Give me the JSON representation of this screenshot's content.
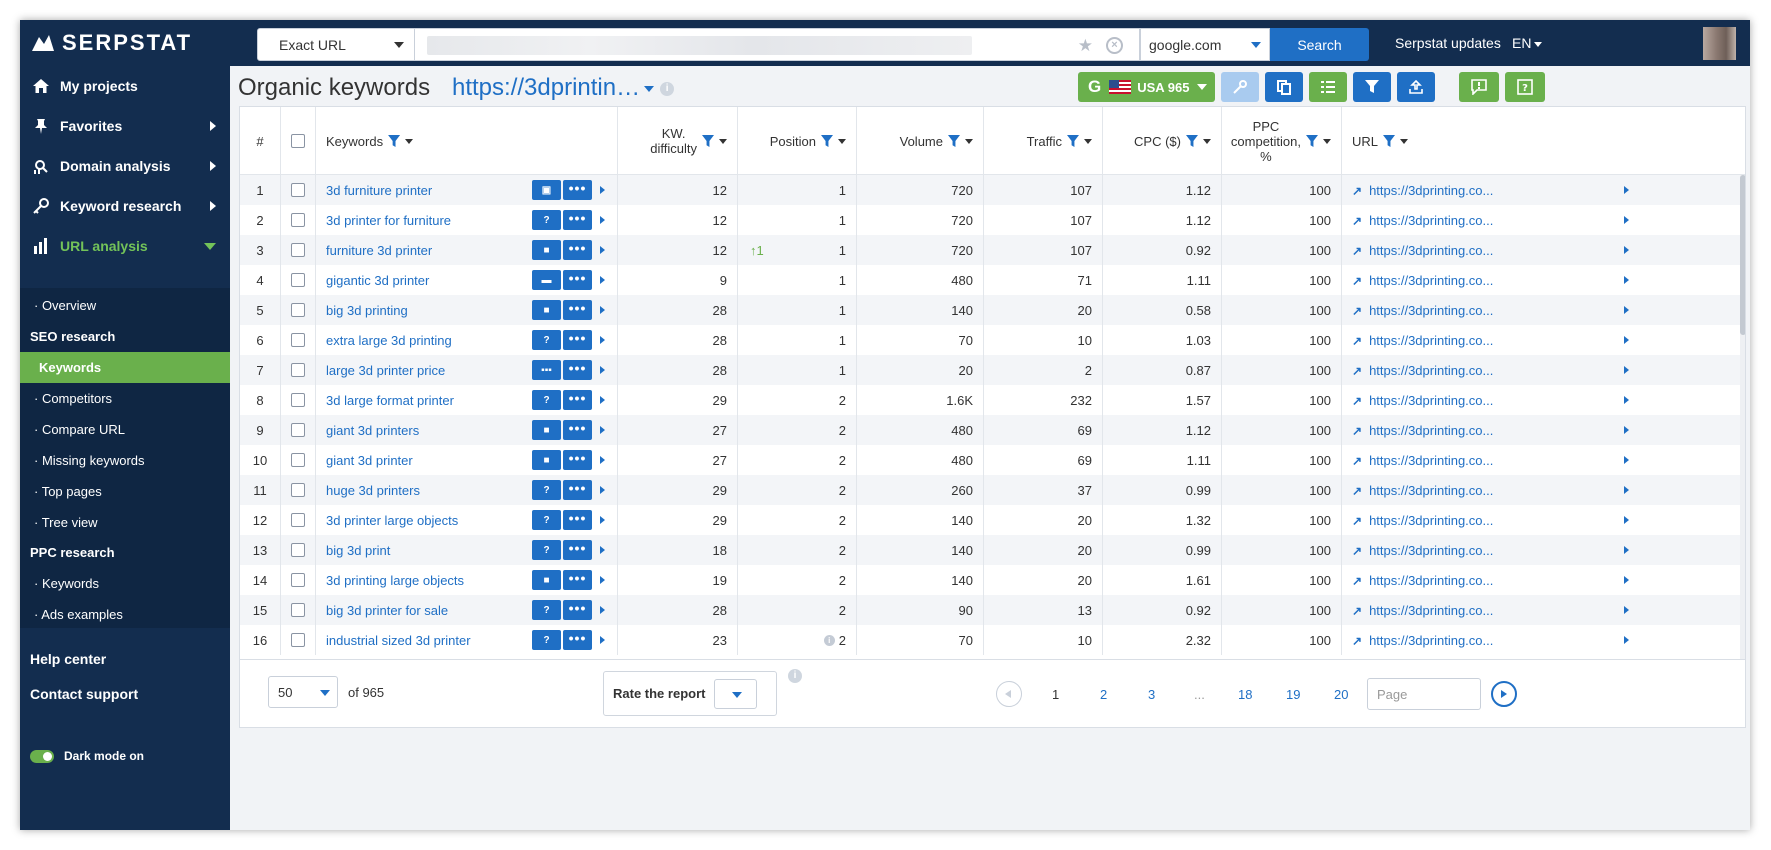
{
  "app": {
    "logo": "SERPSTAT"
  },
  "search": {
    "mode": "Exact URL",
    "engine": "google.com",
    "button": "Search"
  },
  "header": {
    "updates": "Serpstat updates",
    "lang": "EN"
  },
  "sidebar": {
    "items": [
      {
        "label": "My projects",
        "icon": "home-icon"
      },
      {
        "label": "Favorites",
        "icon": "pin-icon"
      },
      {
        "label": "Domain analysis",
        "icon": "domain-analysis-icon"
      },
      {
        "label": "Keyword research",
        "icon": "key-icon"
      },
      {
        "label": "URL analysis",
        "icon": "bar-chart-icon"
      }
    ],
    "sub": {
      "overview": "· Overview",
      "seo_head": "SEO research",
      "keywords": "Keywords",
      "competitors": "· Competitors",
      "compare": "· Compare URL",
      "missing": "· Missing keywords",
      "top_pages": "· Top pages",
      "tree": "· Tree view",
      "ppc_head": "PPC research",
      "ppc_keywords": "· Keywords",
      "ads": "· Ads examples"
    },
    "help": "Help center",
    "contact": "Contact support",
    "dark_mode": "Dark mode on"
  },
  "page": {
    "title": "Organic keywords",
    "url": "https://3dprintin…",
    "region": "USA 965",
    "region_g": "G"
  },
  "table": {
    "headers": {
      "num": "#",
      "keywords": "Keywords",
      "kd1": "KW.",
      "kd2": "difficulty",
      "position": "Position",
      "volume": "Volume",
      "traffic": "Traffic",
      "cpc": "CPC ($)",
      "ppc1": "PPC",
      "ppc2": "competition,",
      "ppc3": "%",
      "url": "URL"
    },
    "rows": [
      {
        "n": "1",
        "kw": "3d furniture printer",
        "serp": "image",
        "kd": "12",
        "change": "",
        "pos": "1",
        "vol": "720",
        "traffic": "107",
        "cpc": "1.12",
        "ppc": "100",
        "url": "https://3dprinting.co..."
      },
      {
        "n": "2",
        "kw": "3d printer for furniture",
        "serp": "faq",
        "kd": "12",
        "change": "",
        "pos": "1",
        "vol": "720",
        "traffic": "107",
        "cpc": "1.12",
        "ppc": "100",
        "url": "https://3dprinting.co..."
      },
      {
        "n": "3",
        "kw": "furniture 3d printer",
        "serp": "video",
        "kd": "12",
        "change": "↑1",
        "pos": "1",
        "vol": "720",
        "traffic": "107",
        "cpc": "0.92",
        "ppc": "100",
        "url": "https://3dprinting.co..."
      },
      {
        "n": "4",
        "kw": "gigantic 3d printer",
        "serp": "shop",
        "kd": "9",
        "change": "",
        "pos": "1",
        "vol": "480",
        "traffic": "71",
        "cpc": "1.11",
        "ppc": "100",
        "url": "https://3dprinting.co..."
      },
      {
        "n": "5",
        "kw": "big 3d printing",
        "serp": "video",
        "kd": "28",
        "change": "",
        "pos": "1",
        "vol": "140",
        "traffic": "20",
        "cpc": "0.58",
        "ppc": "100",
        "url": "https://3dprinting.co..."
      },
      {
        "n": "6",
        "kw": "extra large 3d printing",
        "serp": "faq",
        "kd": "28",
        "change": "",
        "pos": "1",
        "vol": "70",
        "traffic": "10",
        "cpc": "1.03",
        "ppc": "100",
        "url": "https://3dprinting.co..."
      },
      {
        "n": "7",
        "kw": "large 3d printer price",
        "serp": "carousel",
        "kd": "28",
        "change": "",
        "pos": "1",
        "vol": "20",
        "traffic": "2",
        "cpc": "0.87",
        "ppc": "100",
        "url": "https://3dprinting.co..."
      },
      {
        "n": "8",
        "kw": "3d large format printer",
        "serp": "faq",
        "kd": "29",
        "change": "",
        "pos": "2",
        "vol": "1.6K",
        "traffic": "232",
        "cpc": "1.57",
        "ppc": "100",
        "url": "https://3dprinting.co..."
      },
      {
        "n": "9",
        "kw": "giant 3d printers",
        "serp": "video",
        "kd": "27",
        "change": "",
        "pos": "2",
        "vol": "480",
        "traffic": "69",
        "cpc": "1.12",
        "ppc": "100",
        "url": "https://3dprinting.co..."
      },
      {
        "n": "10",
        "kw": "giant 3d printer",
        "serp": "video",
        "kd": "27",
        "change": "",
        "pos": "2",
        "vol": "480",
        "traffic": "69",
        "cpc": "1.11",
        "ppc": "100",
        "url": "https://3dprinting.co..."
      },
      {
        "n": "11",
        "kw": "huge 3d printers",
        "serp": "faq",
        "kd": "29",
        "change": "",
        "pos": "2",
        "vol": "260",
        "traffic": "37",
        "cpc": "0.99",
        "ppc": "100",
        "url": "https://3dprinting.co..."
      },
      {
        "n": "12",
        "kw": "3d printer large objects",
        "serp": "faq",
        "kd": "29",
        "change": "",
        "pos": "2",
        "vol": "140",
        "traffic": "20",
        "cpc": "1.32",
        "ppc": "100",
        "url": "https://3dprinting.co..."
      },
      {
        "n": "13",
        "kw": "big 3d print",
        "serp": "faq",
        "kd": "18",
        "change": "",
        "pos": "2",
        "vol": "140",
        "traffic": "20",
        "cpc": "0.99",
        "ppc": "100",
        "url": "https://3dprinting.co..."
      },
      {
        "n": "14",
        "kw": "3d printing large objects",
        "serp": "video",
        "kd": "19",
        "change": "",
        "pos": "2",
        "vol": "140",
        "traffic": "20",
        "cpc": "1.61",
        "ppc": "100",
        "url": "https://3dprinting.co..."
      },
      {
        "n": "15",
        "kw": "big 3d printer for sale",
        "serp": "faq",
        "kd": "28",
        "change": "",
        "pos": "2",
        "vol": "90",
        "traffic": "13",
        "cpc": "0.92",
        "ppc": "100",
        "url": "https://3dprinting.co..."
      },
      {
        "n": "16",
        "kw": "industrial sized 3d printer",
        "serp": "faq",
        "kd": "23",
        "change": "info",
        "pos": "2",
        "vol": "70",
        "traffic": "10",
        "cpc": "2.32",
        "ppc": "100",
        "url": "https://3dprinting.co..."
      }
    ]
  },
  "footer": {
    "per_page": "50",
    "of_total": "of 965",
    "rate": "Rate the report",
    "pages": [
      "1",
      "2",
      "3",
      "...",
      "18",
      "19",
      "20"
    ],
    "page_placeholder": "Page"
  },
  "colors": {
    "navy": "#132d4f",
    "accent_blue": "#1f6fc5",
    "accent_green": "#6ab04c"
  }
}
